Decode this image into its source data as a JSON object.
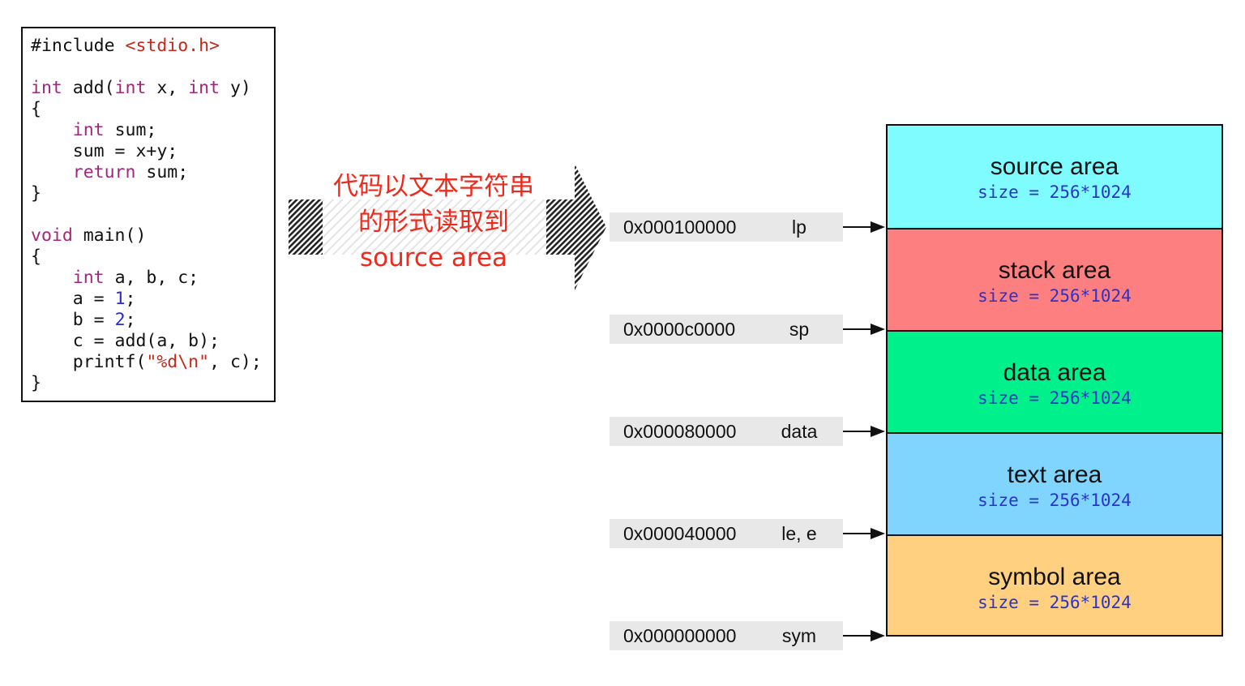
{
  "code": {
    "lines": [
      [
        [
          "pp",
          "#include "
        ],
        [
          "str",
          "<stdio.h>"
        ]
      ],
      [],
      [
        [
          "kw",
          "int"
        ],
        [
          "t",
          " add("
        ],
        [
          "kw",
          "int"
        ],
        [
          "t",
          " x, "
        ],
        [
          "kw",
          "int"
        ],
        [
          "t",
          " y)"
        ]
      ],
      [
        [
          "t",
          "{"
        ]
      ],
      [
        [
          "t",
          "    "
        ],
        [
          "kw",
          "int"
        ],
        [
          "t",
          " sum;"
        ]
      ],
      [
        [
          "t",
          "    sum = x+y;"
        ]
      ],
      [
        [
          "t",
          "    "
        ],
        [
          "kw",
          "return"
        ],
        [
          "t",
          " sum;"
        ]
      ],
      [
        [
          "t",
          "}"
        ]
      ],
      [],
      [
        [
          "kw",
          "void"
        ],
        [
          "t",
          " main()"
        ]
      ],
      [
        [
          "t",
          "{"
        ]
      ],
      [
        [
          "t",
          "    "
        ],
        [
          "kw",
          "int"
        ],
        [
          "t",
          " a, b, c;"
        ]
      ],
      [
        [
          "t",
          "    a = "
        ],
        [
          "num",
          "1"
        ],
        [
          "t",
          ";"
        ]
      ],
      [
        [
          "t",
          "    b = "
        ],
        [
          "num",
          "2"
        ],
        [
          "t",
          ";"
        ]
      ],
      [
        [
          "t",
          "    c = add(a, b);"
        ]
      ],
      [
        [
          "t",
          "    printf("
        ],
        [
          "str",
          "\"%d\\n\""
        ],
        [
          "t",
          ", c);"
        ]
      ],
      [
        [
          "t",
          "}"
        ]
      ]
    ]
  },
  "arrow_caption": [
    "代码以文本字符串",
    "的形式读取到",
    "source area"
  ],
  "pointers": [
    {
      "address": "0x000100000",
      "register": "lp"
    },
    {
      "address": "0x0000c0000",
      "register": "sp"
    },
    {
      "address": "0x000080000",
      "register": "data"
    },
    {
      "address": "0x000040000",
      "register": "le, e"
    },
    {
      "address": "0x000000000",
      "register": "sym"
    }
  ],
  "memory": [
    {
      "name": "source area",
      "size": "size = 256*1024",
      "color": "#7ffcff"
    },
    {
      "name": "stack area",
      "size": "size = 256*1024",
      "color": "#fe7f7f"
    },
    {
      "name": "data area",
      "size": "size = 256*1024",
      "color": "#00f18b"
    },
    {
      "name": "text area",
      "size": "size = 256*1024",
      "color": "#7fd5fd"
    },
    {
      "name": "symbol area",
      "size": "size = 256*1024",
      "color": "#ffd07f"
    }
  ]
}
